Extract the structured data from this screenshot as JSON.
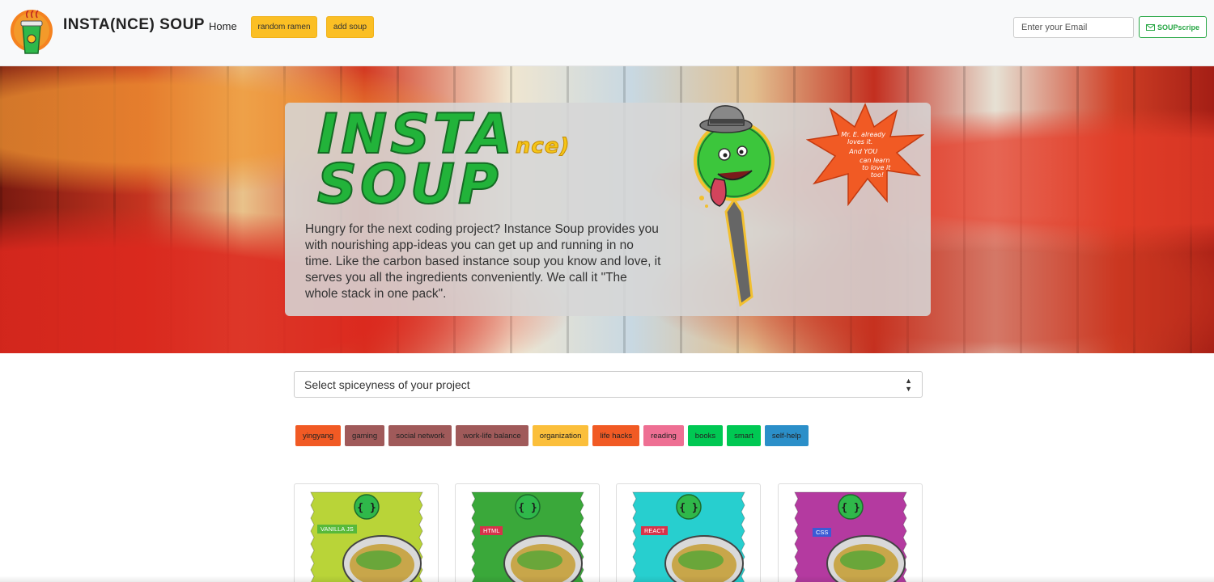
{
  "navbar": {
    "brand": "INSTA(NCE) SOUP",
    "home_label": "Home",
    "random_label": "random ramen",
    "add_label": "add soup",
    "email_placeholder": "Enter your Email",
    "subscribe_label": "SOUPscripe"
  },
  "hero": {
    "title_line1": "INSTA",
    "title_suffix": "nce)",
    "title_line2": "SOUP",
    "description": "Hungry for the next coding project? Instance Soup provides you with nourishing app-ideas you can get up and running in no time. Like the carbon based instance soup you know and love, it serves you all the ingredients conveniently. We call it \"The whole stack in one pack\".",
    "starburst_lines": [
      "Mr. E. already",
      "loves it.",
      "And YOU",
      "can learn",
      "to love it",
      "too!"
    ]
  },
  "select": {
    "selected": "Select spiceyness of your project"
  },
  "tags": [
    {
      "label": "yingyang",
      "color": "#f15a24"
    },
    {
      "label": "gaming",
      "color": "#a05a5a"
    },
    {
      "label": "social network",
      "color": "#a05a5a"
    },
    {
      "label": "work-life balance",
      "color": "#a05a5a"
    },
    {
      "label": "organization",
      "color": "#fbbf3b"
    },
    {
      "label": "life hacks",
      "color": "#f15a24"
    },
    {
      "label": "reading",
      "color": "#ee6f93"
    },
    {
      "label": "books",
      "color": "#00c853"
    },
    {
      "label": "smart",
      "color": "#00c853"
    },
    {
      "label": "self-help",
      "color": "#2b8fc9"
    }
  ],
  "cards": [
    {
      "label": "VANILLA JS",
      "color": "#b9d438",
      "label_color": "#57b93a"
    },
    {
      "label": "HTML",
      "color": "#3aa83a",
      "label_color": "#d6334a"
    },
    {
      "label": "REACT",
      "color": "#27cfcf",
      "label_color": "#d6334a"
    },
    {
      "label": "CSS",
      "color": "#b43aa0",
      "label_color": "#3a5bd6"
    }
  ],
  "colors": {
    "accent_yellow": "#fbbf24",
    "brand_green": "#22b33a",
    "subscribe_green": "#28a745"
  },
  "icons": {
    "logo": "ramen-cup-logo",
    "subscribe": "envelope-icon",
    "select": "updown-arrows-icon",
    "pack": "curly-braces-icon"
  }
}
